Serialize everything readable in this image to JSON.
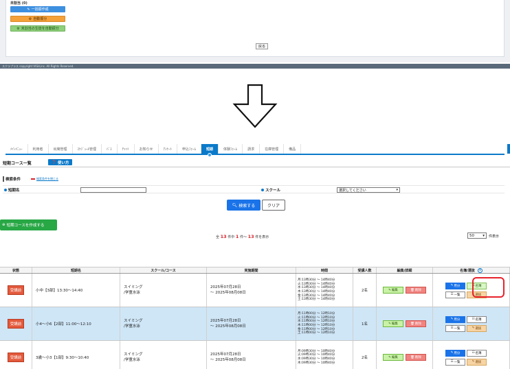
{
  "top_screen": {
    "unassigned_label": "未割当 (0)",
    "bulk_create_label": "一括振作成",
    "auto_assign_label": "自動振分",
    "auto_assign_unassigned_label": "未割当の生徒を自動振分",
    "back_label": "戻る",
    "copyright": "スクラプラス copyright VISH,inc. All Rights Reserved."
  },
  "nav": {
    "items": [
      "ﾒｲﾝﾒﾆｭｰ",
      "利用者",
      "出席管理",
      "ｽｹｼﾞｭｰﾙ管理",
      "ﾊﾞｽ",
      "ﾁｬｯﾄ",
      "お知らせ",
      "ｱﾝｹｰﾄ",
      "申込ﾌｫｰﾑ",
      "短期",
      "体験ﾌｫｰﾑ",
      "請求",
      "在庫管理",
      "備品"
    ],
    "active_index": 9,
    "accent_color": "#0b79c9"
  },
  "page": {
    "title": "短期コース一覧",
    "help_label": "使い方"
  },
  "search": {
    "label": "検索条件",
    "toggle_label": "検索条件を閉じる",
    "course_name_label": "短期名",
    "course_name_value": "",
    "school_label": "スクール",
    "school_select_value": "選択してください",
    "search_button": "検索する",
    "clear_button": "クリア"
  },
  "create_button": "短期コースを作成する",
  "results": {
    "prefix": "全",
    "total": "13",
    "mid1": "件中",
    "from": "1",
    "mid2": "件～",
    "to": "13",
    "suffix": "件を表示",
    "per_page": "50",
    "per_page_label": "件表示"
  },
  "table": {
    "headers": {
      "status": "状態",
      "name": "短期名",
      "school": "スクール/コース",
      "period": "実施期間",
      "time": "時間",
      "count": "受講人数",
      "edit": "編集/詳細",
      "roster": "名簿/選抜"
    },
    "buttons": {
      "edit": "編集",
      "delete": "削除",
      "split": "用分",
      "roster": "名簿",
      "list": "一覧",
      "select": "選抜"
    },
    "rows": [
      {
        "status": "受講前",
        "name": "小中【3部】13:30～14:40",
        "school_line1": "スイミング",
        "school_line2": "/学童水泳",
        "period_line1": "2025年07月28日",
        "period_line2": "～ 2025年08月08日",
        "times": [
          "月:13時30分 ～ 14時40分",
          "火:13時30分 ～ 14時40分",
          "水:13時30分 ～ 14時40分",
          "木:13時30分 ～ 14時40分",
          "金:13時30分 ～ 14時40分",
          "土:13時30分 ～ 14時40分"
        ],
        "count": "2名"
      },
      {
        "status": "受講前",
        "name": "小4～小6【2部】11:00～12:10",
        "school_line1": "スイミング",
        "school_line2": "/学童水泳",
        "period_line1": "2025年07月28日",
        "period_line2": "～ 2025年08月08日",
        "times": [
          "月:11時00分 ～ 12時10分",
          "火:11時00分 ～ 12時10分",
          "水:11時00分 ～ 12時10分",
          "木:11時00分 ～ 12時10分",
          "金:11時00分 ～ 12時10分",
          "土:11時00分 ～ 12時10分"
        ],
        "count": "1名"
      },
      {
        "status": "受講前",
        "name": "3歳～小3【1部】9:30～10:40",
        "school_line1": "スイミング",
        "school_line2": "/学童水泳",
        "period_line1": "2025年07月28日",
        "period_line2": "～ 2025年08月08日",
        "times": [
          "月:09時30分 ～ 10時40分",
          "火:09時30分 ～ 10時40分",
          "水:09時30分 ～ 10時40分",
          "木:09時30分 ～ 10時40分"
        ],
        "count": "2名"
      }
    ]
  }
}
